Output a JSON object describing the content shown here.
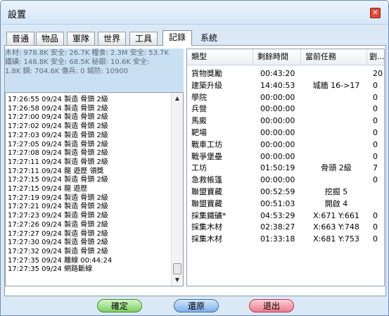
{
  "window": {
    "title": "設置",
    "close_glyph": "✕"
  },
  "tabs": [
    "普通",
    "物品",
    "軍隊",
    "世界",
    "工具",
    "記錄",
    "系統"
  ],
  "active_tab": 5,
  "resources": [
    "木材: 978.8K 安全: 26.7K  糧食: 2.3M 安全: 53.7K",
    "  鐵礦: 148.8K 安全: 68.5K  秘銀: 10.6K 安全:",
    "1.8K  鋼: 704.6K  傷兵: 0  城防: 10900"
  ],
  "log": [
    "17:26:55 09/24  製造  骨頭 2級",
    "17:26:58 09/24  製造  骨頭 2級",
    "17:27:00 09/24  製造  骨頭 2級",
    "17:27:02 09/24  製造  骨頭 2級",
    "17:27:03 09/24  製造  骨頭 2級",
    "17:27:05 09/24  製造  骨頭 2級",
    "17:27:08 09/24  製造  骨頭 2級",
    "17:27:11 09/24  製造  骨頭 2級",
    "17:27:11 09/24  龍  遊歷  領獎",
    "17:27:15 09/24  製造  骨頭 2級",
    "17:27:15 09/24  龍  遊歷",
    "17:27:19 09/24  製造  骨頭 2級",
    "17:27:21 09/24  製造  骨頭 2級",
    "17:27:23 09/24  製造  骨頭 2級",
    "17:27:26 09/24  製造  骨頭 2級",
    "17:27:27 09/24  製造  骨頭 2級",
    "17:27:30 09/24  製造  骨頭 2級",
    "17:27:32 09/24  製造  骨頭 2級",
    "17:27:35 09/24  離線  00:44:24",
    "17:27:35 09/24  網路斷線"
  ],
  "table": {
    "headers": [
      "類型",
      "剩餘時間",
      "當前任務",
      "劉..."
    ],
    "rows": [
      [
        "貨物獎勵",
        "00:43:20",
        "",
        "20"
      ],
      [
        "建築升級",
        "14:40:53",
        "城牆 16->17",
        "0"
      ],
      [
        "學院",
        "00:00:00",
        "",
        "0"
      ],
      [
        "兵營",
        "00:00:00",
        "",
        "0"
      ],
      [
        "馬廄",
        "00:00:00",
        "",
        "0"
      ],
      [
        "靶場",
        "00:00:00",
        "",
        "0"
      ],
      [
        "戰車工坊",
        "00:00:00",
        "",
        "0"
      ],
      [
        "戰爭堡壘",
        "00:00:00",
        "",
        "0"
      ],
      [
        "工坊",
        "01:50:19",
        "骨頭 2級",
        "7"
      ],
      [
        "急救帳篷",
        "00:00:00",
        "",
        "0"
      ],
      [
        "聯盟寶藏",
        "00:52:59",
        "挖掘 5",
        ""
      ],
      [
        "聯盟寶藏",
        "00:51:03",
        "開啟 4",
        ""
      ],
      [
        "採集鐵礦*",
        "04:53:29",
        "X:671 Y:661",
        "0"
      ],
      [
        "採集木材",
        "02:38:27",
        "X:663 Y:748",
        "0"
      ],
      [
        "採集木材",
        "01:33:18",
        "X:681 Y:753",
        "0"
      ]
    ]
  },
  "buttons": {
    "ok": "確定",
    "reset": "還原",
    "exit": "退出"
  },
  "scrollbar": {
    "up_glyph": "▲",
    "down_glyph": "▼"
  }
}
